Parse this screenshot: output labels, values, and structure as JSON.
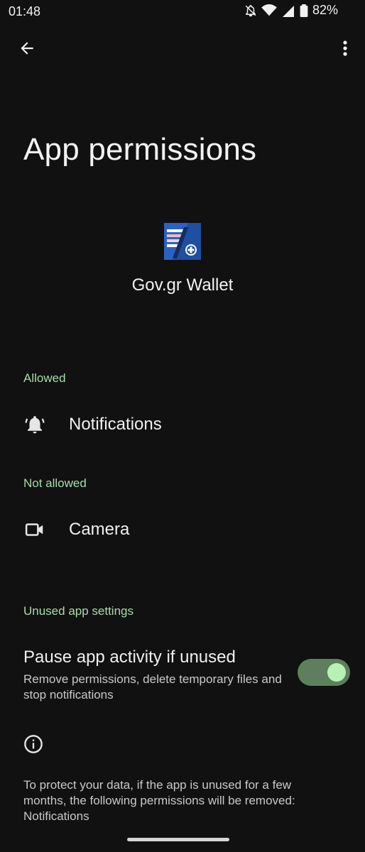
{
  "status_bar": {
    "time": "01:48",
    "battery": "82%",
    "icons": [
      "notifications-off-icon",
      "wifi-icon",
      "signal-icon",
      "battery-icon"
    ]
  },
  "header": {
    "back_icon": "arrow-back-icon",
    "more_icon": "more-vert-icon",
    "title": "App permissions"
  },
  "app": {
    "name": "Gov.gr Wallet"
  },
  "sections": {
    "allowed": {
      "label": "Allowed",
      "items": [
        {
          "label": "Notifications",
          "icon": "bell-icon"
        }
      ]
    },
    "not_allowed": {
      "label": "Not allowed",
      "items": [
        {
          "label": "Camera",
          "icon": "videocam-icon"
        }
      ]
    },
    "unused": {
      "label": "Unused app settings",
      "pause_title": "Pause app activity if unused",
      "pause_description": "Remove permissions, delete temporary files and stop notifications",
      "toggle_on": true
    }
  },
  "info": {
    "icon": "info-icon",
    "text": "To protect your data, if the app is unused for a few months, the following permissions will be removed: Notifications"
  },
  "colors": {
    "background": "#111111",
    "accent_label": "#a8dcae",
    "toggle_track": "#5e7f5e",
    "toggle_knob": "#b9f0b6"
  }
}
